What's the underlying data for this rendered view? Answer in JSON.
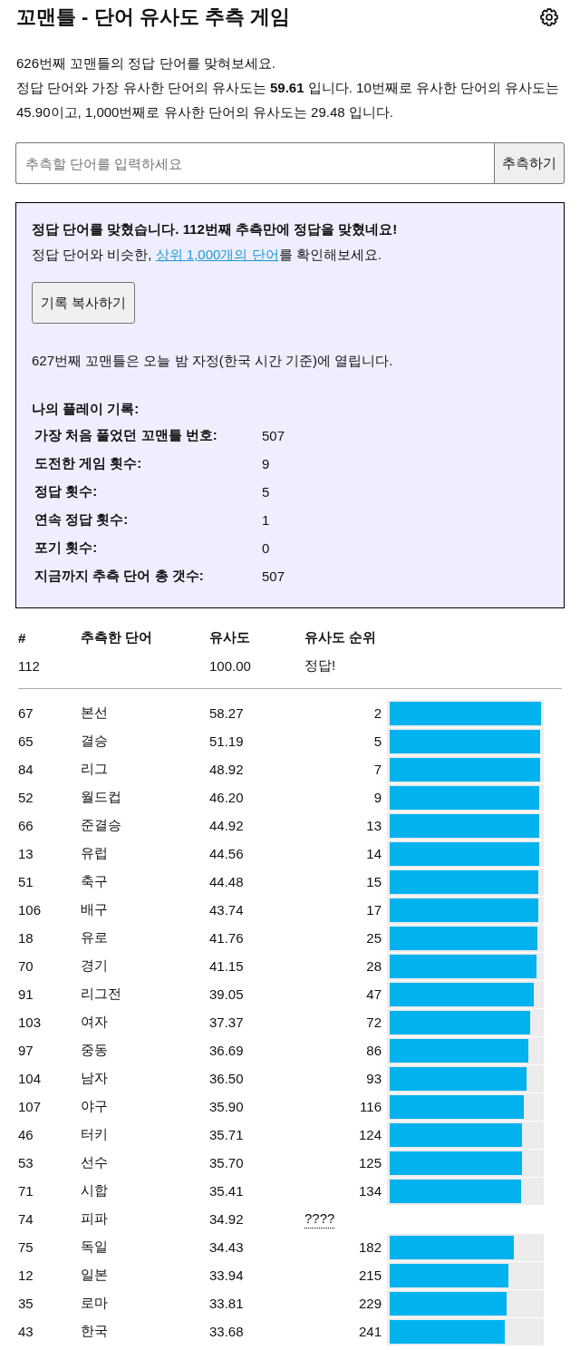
{
  "header": {
    "title": "꼬맨틀 - 단어 유사도 추측 게임"
  },
  "intro": [
    "626번째 꼬맨틀의 정답 단어를 맞혀보세요.",
    "정답 단어와 가장 유사한 단어의 유사도는 **59.61** 입니다. 10번째로 유사한 단어의 유사도는 45.90이고, 1,000번째로 유사한 단어의 유사도는 29.48 입니다."
  ],
  "guess_form": {
    "placeholder": "추측할 단어를 입력하세요",
    "button": "추측하기"
  },
  "result_box": {
    "headline": "정답 단어를 맞혔습니다. 112번째 추측만에 정답을 맞혔네요!",
    "top_words": {
      "before": "정답 단어와 비슷한, ",
      "link": "상위 1,000개의 단어",
      "after": "를 확인해보세요."
    },
    "copy_button": "기록 복사하기",
    "next_notice": "627번째 꼬맨틀은 오늘 밤 자정(한국 시간 기준)에 열립니다.",
    "stats_title": "나의 플레이 기록:",
    "stats": [
      {
        "label": "가장 처음 풀었던 꼬맨틀 번호:",
        "value": "507"
      },
      {
        "label": "도전한 게임 횟수:",
        "value": "9"
      },
      {
        "label": "정답 횟수:",
        "value": "5"
      },
      {
        "label": "연속 정답 횟수:",
        "value": "1"
      },
      {
        "label": "포기 횟수:",
        "value": "0"
      },
      {
        "label": "지금까지 추측 단어 총 갯수:",
        "value": "507"
      }
    ]
  },
  "guesses_table": {
    "columns": [
      "#",
      "추측한 단어",
      "유사도",
      "유사도 순위"
    ],
    "answer_row": {
      "number": "112",
      "similarity": "100.00",
      "rank": "정답!"
    },
    "rows": [
      {
        "number": "67",
        "word": "본선",
        "similarity": "58.27",
        "kind": "ranked",
        "rank": "2",
        "level": 0.998
      },
      {
        "number": "65",
        "word": "결승",
        "similarity": "51.19",
        "kind": "ranked",
        "rank": "5",
        "level": 0.995
      },
      {
        "number": "84",
        "word": "리그",
        "similarity": "48.92",
        "kind": "ranked",
        "rank": "7",
        "level": 0.993
      },
      {
        "number": "52",
        "word": "월드컵",
        "similarity": "46.20",
        "kind": "ranked",
        "rank": "9",
        "level": 0.991
      },
      {
        "number": "66",
        "word": "준결승",
        "similarity": "44.92",
        "kind": "ranked",
        "rank": "13",
        "level": 0.987
      },
      {
        "number": "13",
        "word": "유럽",
        "similarity": "44.56",
        "kind": "ranked",
        "rank": "14",
        "level": 0.986
      },
      {
        "number": "51",
        "word": "축구",
        "similarity": "44.48",
        "kind": "ranked",
        "rank": "15",
        "level": 0.985
      },
      {
        "number": "106",
        "word": "배구",
        "similarity": "43.74",
        "kind": "ranked",
        "rank": "17",
        "level": 0.983
      },
      {
        "number": "18",
        "word": "유로",
        "similarity": "41.76",
        "kind": "ranked",
        "rank": "25",
        "level": 0.975
      },
      {
        "number": "70",
        "word": "경기",
        "similarity": "41.15",
        "kind": "ranked",
        "rank": "28",
        "level": 0.972
      },
      {
        "number": "91",
        "word": "리그전",
        "similarity": "39.05",
        "kind": "ranked",
        "rank": "47",
        "level": 0.953
      },
      {
        "number": "103",
        "word": "여자",
        "similarity": "37.37",
        "kind": "ranked",
        "rank": "72",
        "level": 0.928
      },
      {
        "number": "97",
        "word": "중동",
        "similarity": "36.69",
        "kind": "ranked",
        "rank": "86",
        "level": 0.914
      },
      {
        "number": "104",
        "word": "남자",
        "similarity": "36.50",
        "kind": "ranked",
        "rank": "93",
        "level": 0.907
      },
      {
        "number": "107",
        "word": "야구",
        "similarity": "35.90",
        "kind": "ranked",
        "rank": "116",
        "level": 0.884
      },
      {
        "number": "46",
        "word": "터키",
        "similarity": "35.71",
        "kind": "ranked",
        "rank": "124",
        "level": 0.876
      },
      {
        "number": "53",
        "word": "선수",
        "similarity": "35.70",
        "kind": "ranked",
        "rank": "125",
        "level": 0.875
      },
      {
        "number": "71",
        "word": "시합",
        "similarity": "35.41",
        "kind": "ranked",
        "rank": "134",
        "level": 0.866
      },
      {
        "number": "74",
        "word": "피파",
        "similarity": "34.92",
        "kind": "unknown",
        "rank": "????"
      },
      {
        "number": "75",
        "word": "독일",
        "similarity": "34.43",
        "kind": "ranked",
        "rank": "182",
        "level": 0.818
      },
      {
        "number": "12",
        "word": "일본",
        "similarity": "33.94",
        "kind": "ranked",
        "rank": "215",
        "level": 0.785
      },
      {
        "number": "35",
        "word": "로마",
        "similarity": "33.81",
        "kind": "ranked",
        "rank": "229",
        "level": 0.771
      },
      {
        "number": "43",
        "word": "한국",
        "similarity": "33.68",
        "kind": "ranked",
        "rank": "241",
        "level": 0.759
      }
    ]
  }
}
